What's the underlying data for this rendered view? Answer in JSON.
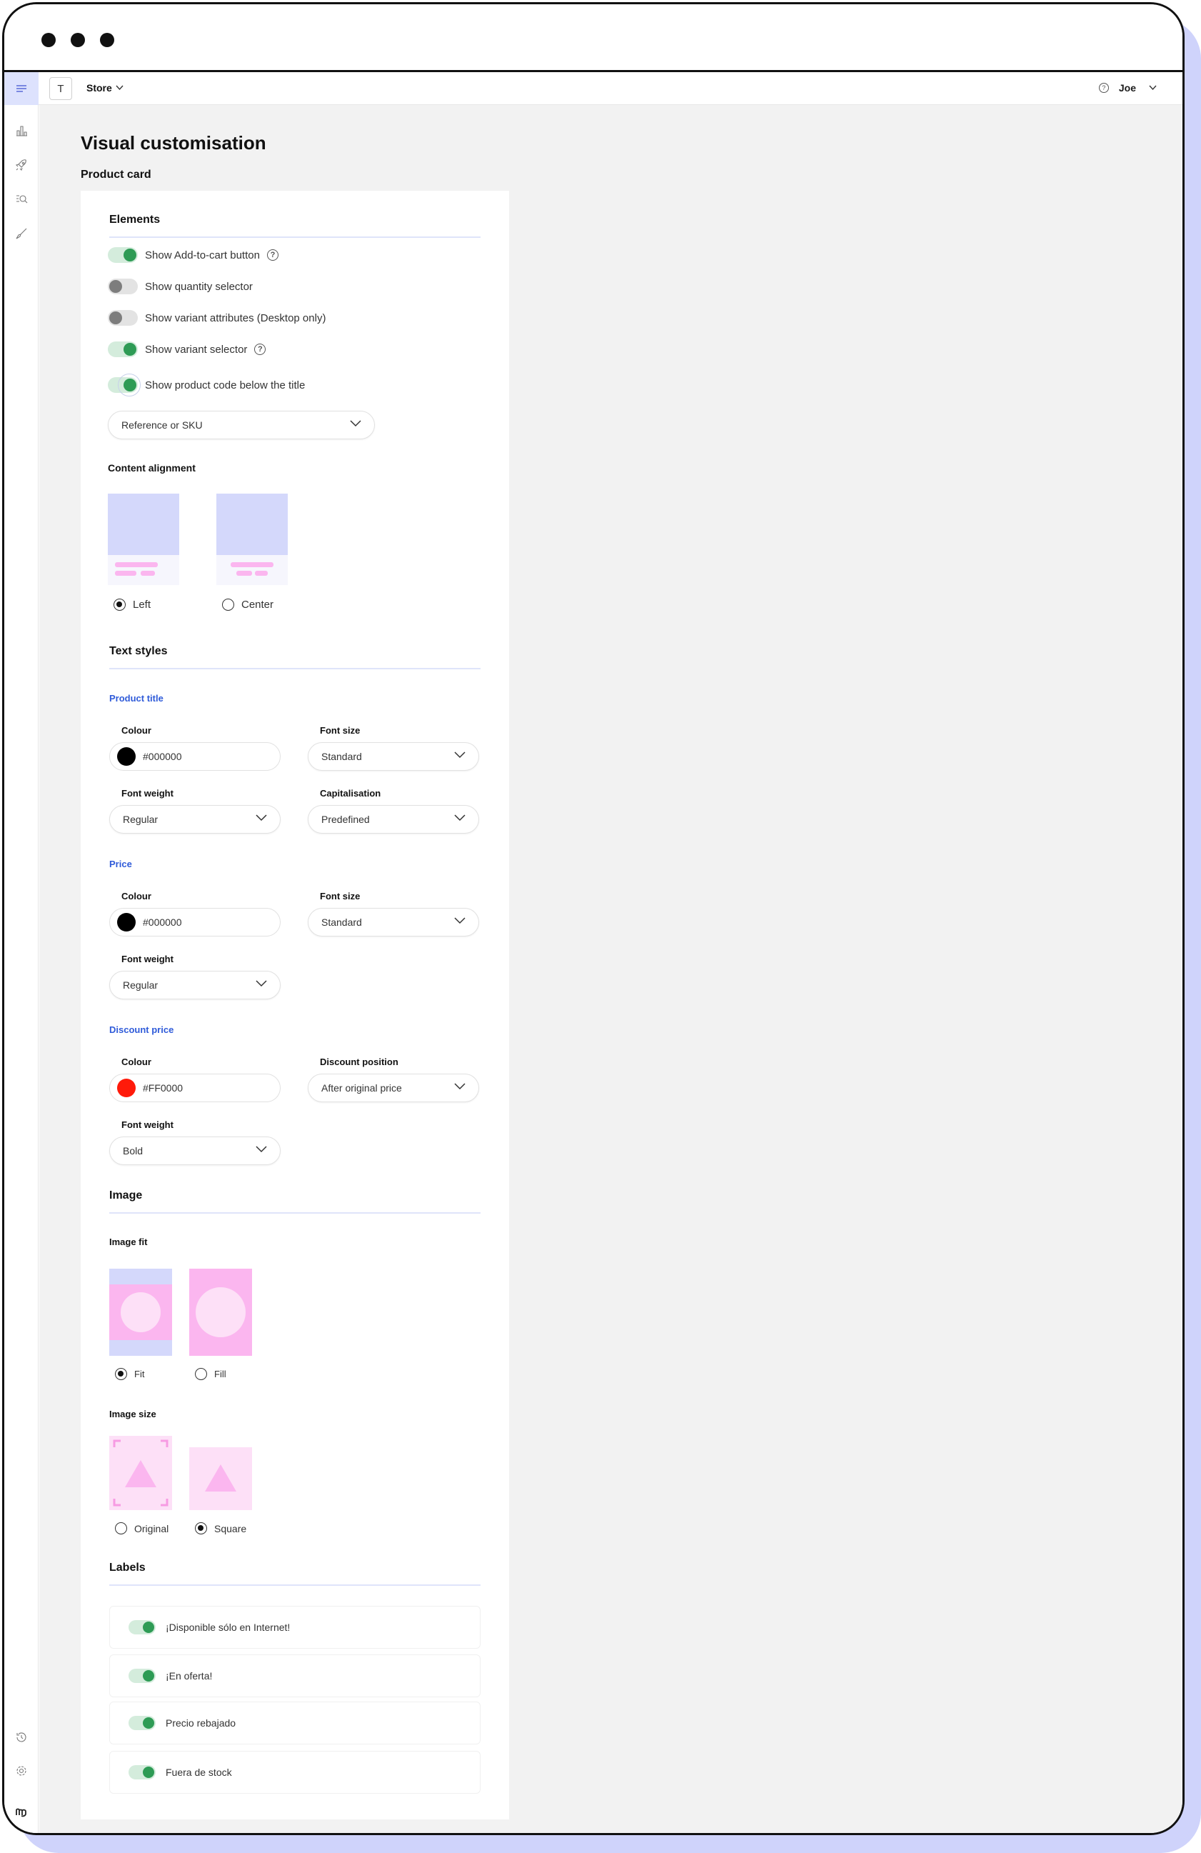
{
  "topbar": {
    "store_initial": "T",
    "store_name": "Store",
    "user_name": "Joe"
  },
  "page": {
    "title": "Visual customisation",
    "section": "Product card"
  },
  "elements": {
    "heading": "Elements",
    "toggles": [
      {
        "label": "Show Add-to-cart button",
        "on": true,
        "help": true
      },
      {
        "label": "Show quantity selector",
        "on": false,
        "help": false
      },
      {
        "label": "Show variant attributes (Desktop only)",
        "on": false,
        "help": false
      },
      {
        "label": "Show variant selector",
        "on": true,
        "help": true
      },
      {
        "label": "Show product code below the title",
        "on": true,
        "help": false
      }
    ],
    "code_select": "Reference or SKU"
  },
  "alignment": {
    "heading": "Content alignment",
    "left": "Left",
    "center": "Center",
    "selected": "Left"
  },
  "text_styles": {
    "heading": "Text styles",
    "product_title": {
      "heading": "Product title",
      "colour_label": "Colour",
      "colour": "#000000",
      "font_size_label": "Font size",
      "font_size": "Standard",
      "font_weight_label": "Font weight",
      "font_weight": "Regular",
      "capitalisation_label": "Capitalisation",
      "capitalisation": "Predefined"
    },
    "price": {
      "heading": "Price",
      "colour_label": "Colour",
      "colour": "#000000",
      "font_size_label": "Font size",
      "font_size": "Standard",
      "font_weight_label": "Font weight",
      "font_weight": "Regular"
    },
    "discount_price": {
      "heading": "Discount price",
      "colour_label": "Colour",
      "colour": "#FF0000",
      "position_label": "Discount position",
      "position": "After original price",
      "font_weight_label": "Font weight",
      "font_weight": "Bold"
    }
  },
  "image": {
    "heading": "Image",
    "fit_heading": "Image fit",
    "fit": "Fit",
    "fill": "Fill",
    "fit_selected": "Fit",
    "size_heading": "Image size",
    "original": "Original",
    "square": "Square",
    "size_selected": "Square"
  },
  "labels": {
    "heading": "Labels",
    "items": [
      {
        "label": "¡Disponible sólo en Internet!",
        "on": true
      },
      {
        "label": "¡En oferta!",
        "on": true
      },
      {
        "label": "Precio rebajado",
        "on": true
      },
      {
        "label": "Fuera de stock",
        "on": true
      }
    ]
  },
  "colors": {
    "accent_blue": "#2f5bd9",
    "toggle_green": "#2e9b55",
    "preview_lavender": "#d4d8fb",
    "preview_pink": "#fbb6ef",
    "frame": "#cfd3fb"
  }
}
